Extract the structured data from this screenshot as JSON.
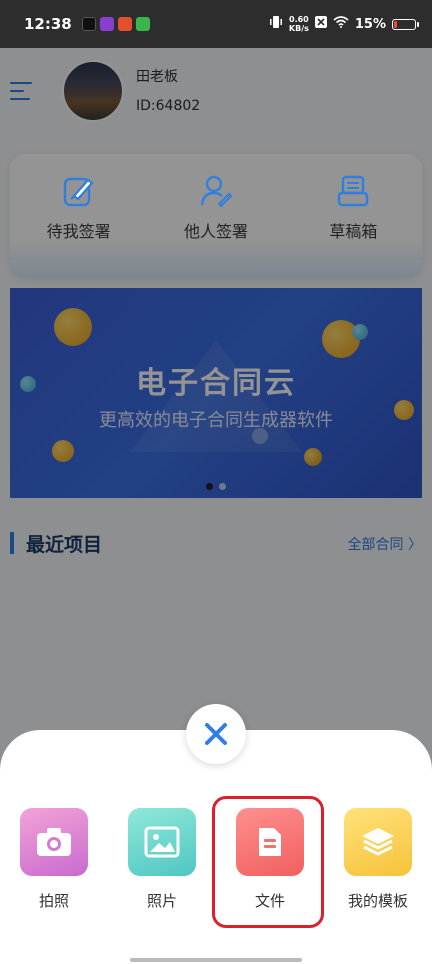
{
  "status_bar": {
    "time": "12:38",
    "net_speed_top": "0.60",
    "net_speed_bottom": "KB/s",
    "battery": "15%",
    "battery_level": 0.15,
    "battery_color": "#e74c3c"
  },
  "user": {
    "name": "田老板",
    "id": "ID:64802"
  },
  "quick_actions": [
    {
      "label": "待我签署",
      "icon": "edit-sign-icon"
    },
    {
      "label": "他人签署",
      "icon": "person-sign-icon"
    },
    {
      "label": "草稿箱",
      "icon": "drafts-icon"
    }
  ],
  "banner": {
    "title": "电子合同云",
    "subtitle": "更高效的电子合同生成器软件",
    "active_slide": 1,
    "slide_count": 2
  },
  "recent": {
    "title": "最近项目",
    "link": "全部合同 〉"
  },
  "sheet": {
    "close_icon": "close-icon",
    "actions": [
      {
        "label": "拍照",
        "icon": "camera-icon",
        "color_from": "#f2a3d6",
        "color_to": "#c96ad0"
      },
      {
        "label": "照片",
        "icon": "image-icon",
        "color_from": "#8fe8d8",
        "color_to": "#4fc6c3"
      },
      {
        "label": "文件",
        "icon": "document-icon",
        "color_from": "#ff8f8f",
        "color_to": "#f0605e"
      },
      {
        "label": "我的模板",
        "icon": "layers-icon",
        "color_from": "#ffe27a",
        "color_to": "#f6c23a"
      }
    ]
  },
  "colors": {
    "accent": "#2f7fe0",
    "highlight": "#d9202b"
  }
}
